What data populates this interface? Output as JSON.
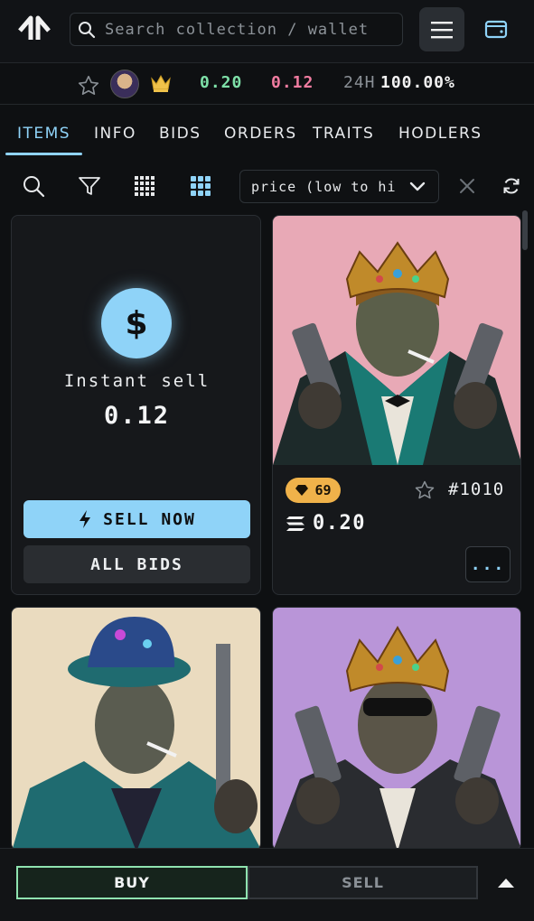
{
  "header": {
    "search_placeholder": "Search collection / wallet",
    "logo_icon": "brand-logo-icon",
    "menu_icon": "hamburger-menu-icon",
    "wallet_icon": "wallet-icon"
  },
  "stats": {
    "floor": "0.20",
    "top_bid": "0.12",
    "change_label": "24H",
    "change_value": "100.00%",
    "colors": {
      "floor": "#7ee0a8",
      "bid": "#f07ca0"
    }
  },
  "tabs": [
    {
      "label": "ITEMS",
      "active": true
    },
    {
      "label": "INFO"
    },
    {
      "label": "BIDS"
    },
    {
      "label": "ORDERS"
    },
    {
      "label": "TRAITS"
    },
    {
      "label": "HODLERS"
    }
  ],
  "toolbar": {
    "sort_value": "price (low to hi",
    "active_view": "grid-large"
  },
  "instant_sell": {
    "icon": "$",
    "label": "Instant sell",
    "value": "0.12",
    "sell_now_label": "SELL NOW",
    "all_bids_label": "ALL BIDS"
  },
  "items": [
    {
      "rank": "69",
      "id": "#1010",
      "price": "0.20",
      "more_label": "..."
    }
  ],
  "bottom": {
    "buy_label": "BUY",
    "sell_label": "SELL"
  },
  "accent": "#8fd3f8"
}
